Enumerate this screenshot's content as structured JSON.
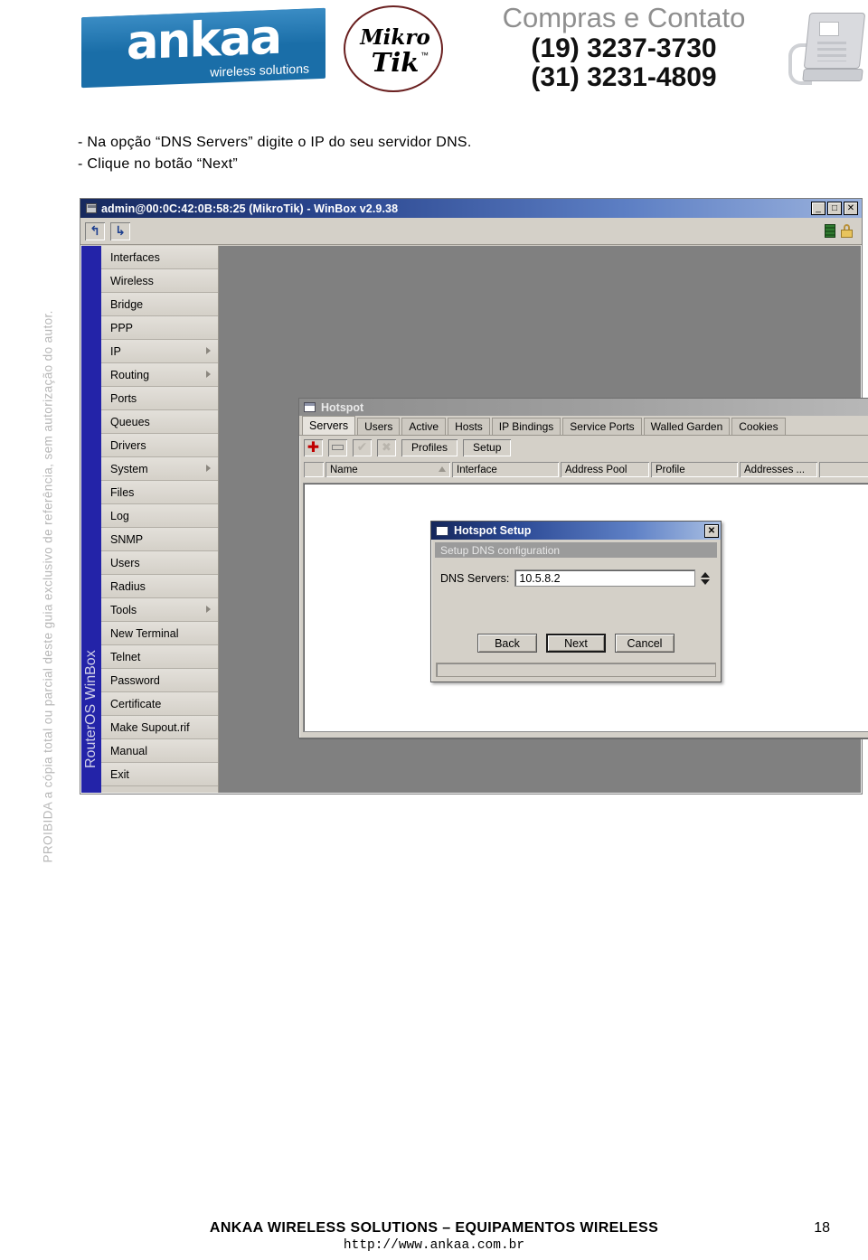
{
  "header": {
    "logo_word": "ankaa",
    "logo_tagline": "wireless solutions",
    "mikrotik_top": "Mikro",
    "mikrotik_bottom": "Tik",
    "mikrotik_tm": "™",
    "contact_title": "Compras e Contato",
    "contact_phone_1": "(19) 3237-3730",
    "contact_phone_2": "(31) 3231-4809"
  },
  "watermark": "PROIBIDA a cópia total ou parcial deste guia exclusivo de referência, sem autorização do autor.",
  "instructions": [
    "- Na opção “DNS Servers” digite o IP do seu servidor DNS.",
    "- Clique no botão “Next”"
  ],
  "winbox": {
    "title": "admin@00:0C:42:0B:58:25 (MikroTik) - WinBox v2.9.38",
    "minimize_label": "_",
    "maximize_label": "□",
    "close_label": "✕",
    "undo_label": "↰",
    "redo_label": "↳",
    "rail_label": "RouterOS WinBox",
    "menu": [
      {
        "label": "Interfaces",
        "submenu": false
      },
      {
        "label": "Wireless",
        "submenu": false
      },
      {
        "label": "Bridge",
        "submenu": false
      },
      {
        "label": "PPP",
        "submenu": false
      },
      {
        "label": "IP",
        "submenu": true
      },
      {
        "label": "Routing",
        "submenu": true
      },
      {
        "label": "Ports",
        "submenu": false
      },
      {
        "label": "Queues",
        "submenu": false
      },
      {
        "label": "Drivers",
        "submenu": false
      },
      {
        "label": "System",
        "submenu": true
      },
      {
        "label": "Files",
        "submenu": false
      },
      {
        "label": "Log",
        "submenu": false
      },
      {
        "label": "SNMP",
        "submenu": false
      },
      {
        "label": "Users",
        "submenu": false
      },
      {
        "label": "Radius",
        "submenu": false
      },
      {
        "label": "Tools",
        "submenu": true
      },
      {
        "label": "New Terminal",
        "submenu": false
      },
      {
        "label": "Telnet",
        "submenu": false
      },
      {
        "label": "Password",
        "submenu": false
      },
      {
        "label": "Certificate",
        "submenu": false
      },
      {
        "label": "Make Supout.rif",
        "submenu": false
      },
      {
        "label": "Manual",
        "submenu": false
      },
      {
        "label": "Exit",
        "submenu": false
      }
    ]
  },
  "hotspot": {
    "title": "Hotspot",
    "close_label": "✕",
    "tabs": [
      {
        "label": "Servers",
        "active": true
      },
      {
        "label": "Users",
        "active": false
      },
      {
        "label": "Active",
        "active": false
      },
      {
        "label": "Hosts",
        "active": false
      },
      {
        "label": "IP Bindings",
        "active": false
      },
      {
        "label": "Service Ports",
        "active": false
      },
      {
        "label": "Walled Garden",
        "active": false
      },
      {
        "label": "Cookies",
        "active": false
      }
    ],
    "toolbar": {
      "add_label": "✚",
      "remove_label": "",
      "enable_label": "✔",
      "disable_label": "✖",
      "profiles_label": "Profiles",
      "setup_label": "Setup"
    },
    "columns": [
      "Name",
      "Interface",
      "Address Pool",
      "Profile",
      "Addresses ..."
    ]
  },
  "setup_dialog": {
    "title": "Hotspot Setup",
    "close_label": "✕",
    "step_label": "Setup DNS configuration",
    "field_label": "DNS Servers:",
    "field_value": "10.5.8.2",
    "buttons": {
      "back": "Back",
      "next": "Next",
      "cancel": "Cancel"
    }
  },
  "footer": {
    "main": "ANKAA WIRELESS SOLUTIONS – EQUIPAMENTOS WIRELESS",
    "url": "http://www.ankaa.com.br",
    "page": "18"
  },
  "colors": {
    "brand_blue": "#1a6ea8",
    "winbox_title": "#17295e",
    "rail_blue": "#2323a8",
    "face": "#d4d0c8",
    "desktop": "#808080",
    "add_red": "#c00000"
  }
}
